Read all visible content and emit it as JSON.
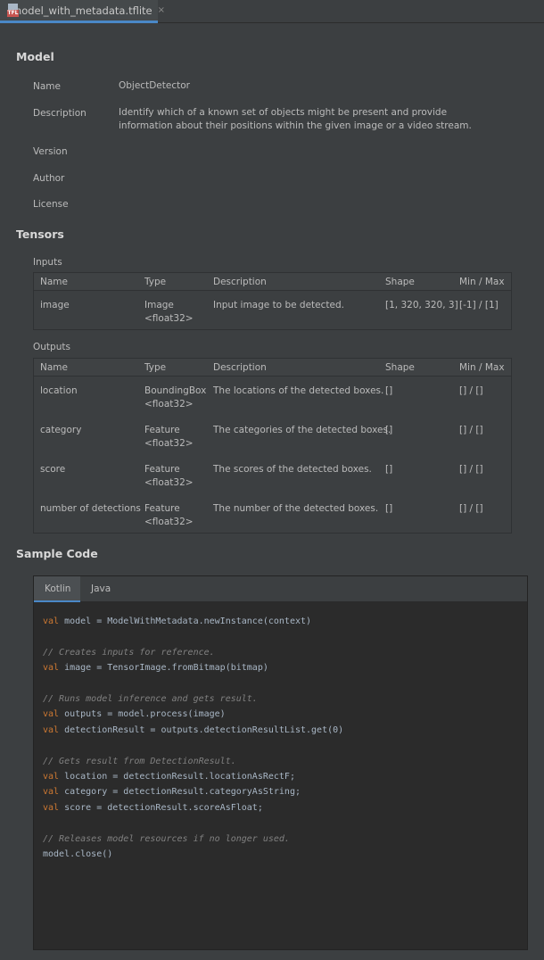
{
  "tab": {
    "file_name": "model_with_metadata.tflite",
    "close_glyph": "×"
  },
  "model": {
    "title": "Model",
    "name_label": "Name",
    "name_value": "ObjectDetector",
    "description_label": "Description",
    "description_line1": "Identify which of a known set of objects might be present and provide",
    "description_line2": "information about their positions within the given image or a video stream.",
    "version_label": "Version",
    "author_label": "Author",
    "license_label": "License"
  },
  "tensors": {
    "title": "Tensors",
    "inputs_label": "Inputs",
    "outputs_label": "Outputs",
    "columns": [
      "Name",
      "Type",
      "Description",
      "Shape",
      "Min / Max"
    ],
    "inputs": [
      {
        "name": "image",
        "type1": "Image",
        "type2": "<float32>",
        "description": "Input image to be detected.",
        "shape": "[1, 320, 320, 3]",
        "minmax": "[-1] / [1]"
      }
    ],
    "outputs": [
      {
        "name": "location",
        "type1": "BoundingBox",
        "type2": "<float32>",
        "description": "The locations of the detected boxes.",
        "shape": "[]",
        "minmax": "[] / []"
      },
      {
        "name": "category",
        "type1": "Feature",
        "type2": "<float32>",
        "description": "The categories of the detected boxes.",
        "shape": "[]",
        "minmax": "[] / []"
      },
      {
        "name": "score",
        "type1": "Feature",
        "type2": "<float32>",
        "description": "The scores of the detected boxes.",
        "shape": "[]",
        "minmax": "[] / []"
      },
      {
        "name": "number of detections",
        "type1": "Feature",
        "type2": "<float32>",
        "description": "The number of the detected boxes.",
        "shape": "[]",
        "minmax": "[] / []"
      }
    ]
  },
  "sample_code": {
    "title": "Sample Code",
    "tabs": [
      "Kotlin",
      "Java"
    ],
    "lines": {
      "l1_kw": "val",
      "l1_rest": " model = ModelWithMetadata.newInstance(context)",
      "l2": "// Creates inputs for reference.",
      "l3_kw": "val",
      "l3_rest": " image = TensorImage.fromBitmap(bitmap)",
      "l4": "// Runs model inference and gets result.",
      "l5_kw": "val",
      "l5_rest": " outputs = model.process(image)",
      "l6_kw": "val",
      "l6_rest": " detectionResult = outputs.detectionResultList.get(0)",
      "l7": "// Gets result from DetectionResult.",
      "l8_kw": "val",
      "l8_rest": " location = detectionResult.locationAsRectF;",
      "l9_kw": "val",
      "l9_rest": " category = detectionResult.categoryAsString;",
      "l10_kw": "val",
      "l10_rest": " score = detectionResult.scoreAsFloat;",
      "l11": "// Releases model resources if no longer used.",
      "l12": "model.close()"
    }
  }
}
